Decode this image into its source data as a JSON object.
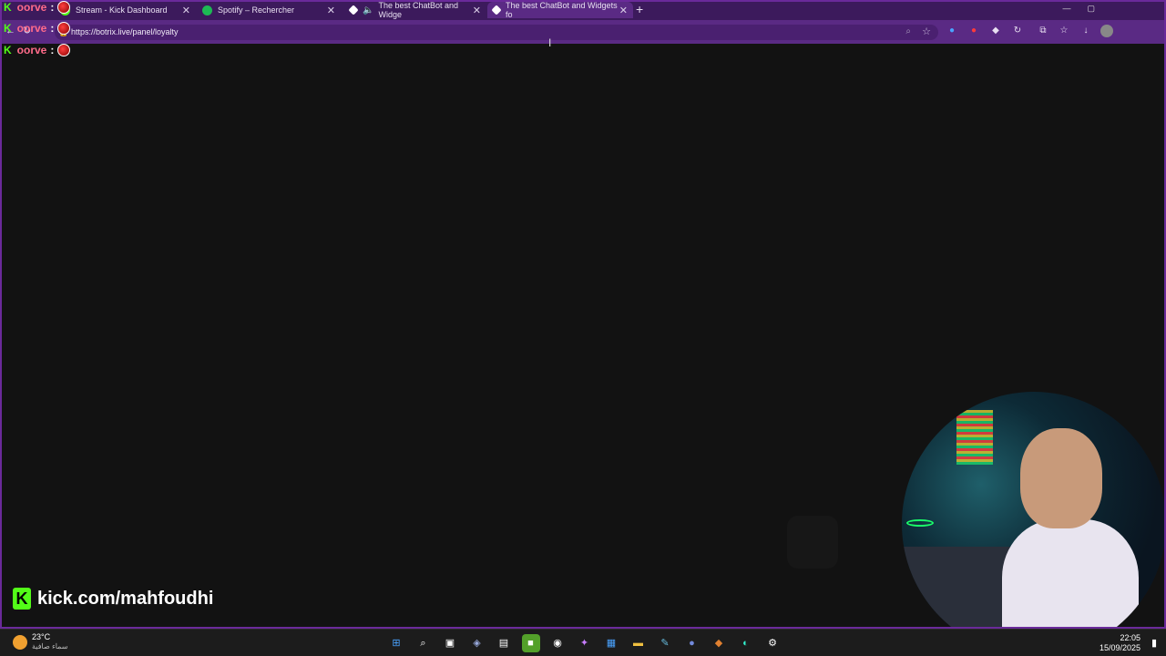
{
  "browser": {
    "tabs": [
      {
        "label": "Stream - Kick Dashboard",
        "icon": "kick-icon",
        "color": "#53fc18"
      },
      {
        "label": "Spotify – Rechercher",
        "icon": "spotify-icon",
        "color": "#1db954"
      },
      {
        "label": "The best ChatBot and Widge",
        "icon": "botrix-icon",
        "color": "#ffffff"
      },
      {
        "label": "The best ChatBot and Widgets fo",
        "icon": "botrix-icon",
        "color": "#ffffff",
        "active": true
      }
    ],
    "new_tab": "+",
    "url": "https://botrix.live/panel/loyalty"
  },
  "chat": {
    "lines": [
      {
        "user": "oorve",
        "sep": ":"
      },
      {
        "user": "oorve",
        "sep": ":"
      },
      {
        "user": "oorve",
        "sep": ":"
      }
    ]
  },
  "overlay": {
    "channel_url": "kick.com/mahfoudhi"
  },
  "taskbar": {
    "weather_temp": "23°C",
    "weather_condition": "سماء صافية",
    "time": "22:05",
    "date": "15/09/2025"
  },
  "colors": {
    "accent": "#5a2a84",
    "kick_green": "#53fc18",
    "chat_name": "#ff6b8a"
  }
}
